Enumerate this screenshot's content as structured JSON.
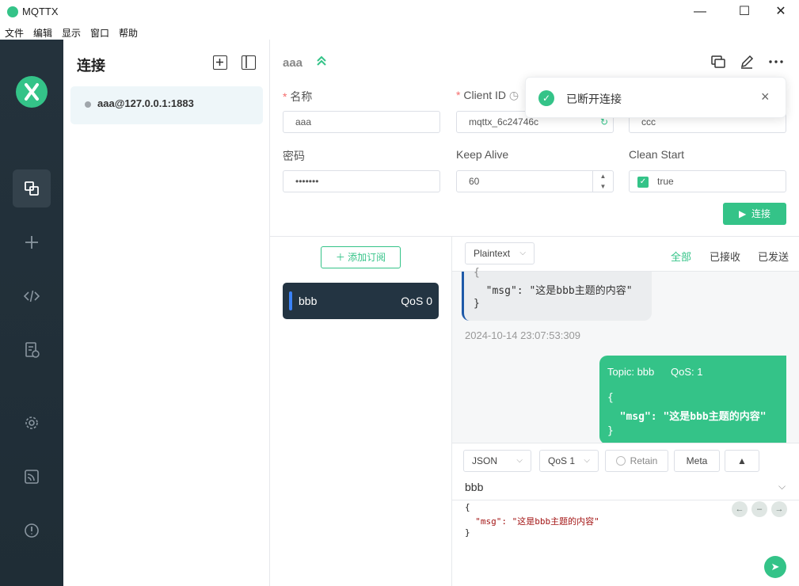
{
  "window": {
    "title": "MQTTX",
    "minimize": "—",
    "maximize": "☐",
    "close": "✕"
  },
  "menu": [
    "文件",
    "编辑",
    "显示",
    "窗口",
    "帮助"
  ],
  "nav": {
    "items": [
      "connections-icon",
      "new-connection-icon",
      "script-icon",
      "log-icon",
      "settings-icon",
      "feed-icon",
      "about-icon"
    ],
    "active": "connections-icon"
  },
  "connections": {
    "title": "连接",
    "items": [
      {
        "label": "aaa@127.0.0.1:1883",
        "status": "disconnected"
      }
    ]
  },
  "header": {
    "name": "aaa",
    "collapse_icon": "double-chevron-up-icon"
  },
  "form": {
    "name_label": "名称",
    "name_value": "aaa",
    "client_id_label": "Client ID",
    "client_id_value": "mqttx_6c24746c",
    "username_value": "ccc",
    "password_label": "密码",
    "password_value": "•••••••",
    "keepalive_label": "Keep Alive",
    "keepalive_value": "60",
    "clean_start_label": "Clean Start",
    "clean_start_value": "true",
    "connect_label": "连接"
  },
  "toast": {
    "text": "已断开连接",
    "close": "×"
  },
  "subscriptions": {
    "add_label": "添加订阅",
    "items": [
      {
        "topic": "bbb",
        "qos": "QoS 0",
        "color": "#3b82f6"
      }
    ]
  },
  "messages": {
    "format": "Plaintext",
    "filters": [
      "全部",
      "已接收",
      "已发送"
    ],
    "active_filter": "全部",
    "received": {
      "lines": [
        "{",
        "  \"msg\": \"这是bbb主题的内容\"",
        "}"
      ],
      "time": "2024-10-14 23:07:53:309"
    },
    "sent": {
      "topic": "Topic: bbb",
      "qos": "QoS: 1",
      "lines": [
        "{",
        "  \"msg\": \"这是bbb主题的内容\"",
        "}"
      ]
    }
  },
  "composer": {
    "format": "JSON",
    "qos": "QoS 1",
    "retain": "Retain",
    "meta": "Meta",
    "topic": "bbb",
    "payload_lines": [
      "{",
      "  \"msg\": \"这是bbb主题的内容\"",
      "}"
    ]
  },
  "colors": {
    "accent": "#34c388",
    "nav_bg": "#24323c",
    "sub_card": "#233442"
  }
}
